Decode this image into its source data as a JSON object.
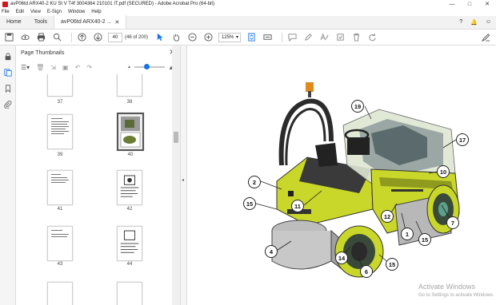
{
  "window": {
    "title": "avP06td ARX40-2 KU St V T4f 3004364 210101 IT.pdf (SECURED) - Adobe Acrobat Pro (64-bit)",
    "controls": [
      "—",
      "□",
      "✕"
    ]
  },
  "menu": [
    "File",
    "Edit",
    "View",
    "E-Sign",
    "Window",
    "Help"
  ],
  "tabs": {
    "home": "Home",
    "tools": "Tools",
    "document": "avP06td ARX40-2 ..."
  },
  "toolbar": {
    "page_number": "40",
    "page_count": "(46 of 200)",
    "zoom": "125%"
  },
  "panel": {
    "title": "Page Thumbnails",
    "thumbnails": [
      "37",
      "38",
      "39",
      "40",
      "41",
      "42",
      "43",
      "44"
    ],
    "selected_page": "40"
  },
  "diagram": {
    "callouts": [
      "19",
      "17",
      "10",
      "2",
      "15",
      "11",
      "7",
      "12",
      "1",
      "15",
      "4",
      "14",
      "6",
      "15"
    ]
  },
  "watermark": {
    "line1": "Activate Windows",
    "line2": "Go to Settings to activate Windows."
  },
  "colors": {
    "accent": "#1473e6",
    "machine_green": "#c9d62a",
    "acrobat_red": "#d0191f"
  }
}
